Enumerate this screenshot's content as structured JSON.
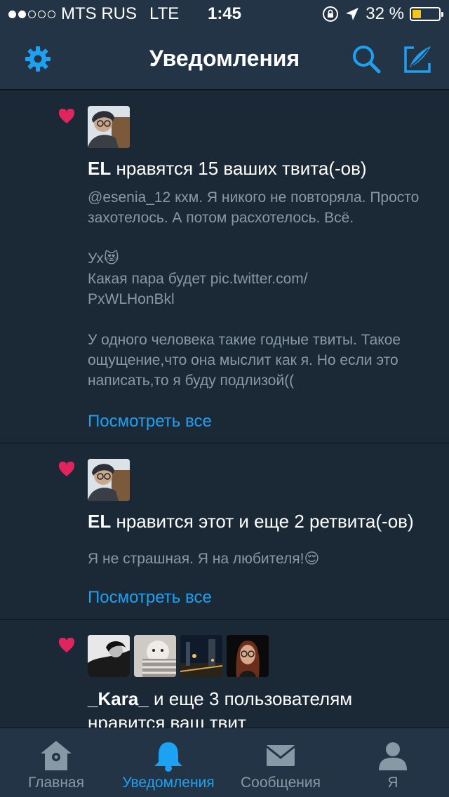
{
  "status_bar": {
    "carrier": "MTS RUS",
    "network": "LTE",
    "time": "1:45",
    "battery_percent": "32 %",
    "battery_level": 0.32,
    "signal_strength": 2,
    "signal_max": 5
  },
  "nav": {
    "title": "Уведомления",
    "settings_icon": "gear-icon",
    "search_icon": "search-icon",
    "compose_icon": "compose-icon"
  },
  "notifications": [
    {
      "user": "EL",
      "action": "нравятся 15 ваших твита(-ов)",
      "body": "@esenia_12  кхм. Я никого не повторяла. Просто захотелось. А потом расхотелось. Всё.\n\nУх😻\nКакая пара будет pic.twitter.com/\nPxWLHonBkl\n\nУ одного человека такие годные твиты. Такое ощущение,что она мыслит как я. Но если это написать,то я буду подлизой((",
      "see_all": "Посмотреть все"
    },
    {
      "user": "EL",
      "action": "нравится этот и еще 2 ретвита(-ов)",
      "body": "Я не страшная. Я на любителя!😌",
      "see_all": "Посмотреть все"
    },
    {
      "user": "_Kara_",
      "action": "и еще 3 пользователям нравится ваш твит"
    }
  ],
  "tabs": [
    {
      "label": "Главная",
      "icon": "home-icon"
    },
    {
      "label": "Уведомления",
      "icon": "bell-icon",
      "active": true
    },
    {
      "label": "Сообщения",
      "icon": "envelope-icon"
    },
    {
      "label": "Я",
      "icon": "profile-icon"
    }
  ],
  "colors": {
    "accent": "#1da1f2",
    "like": "#e0245e",
    "card_bg": "#1b2836",
    "bar_bg": "#243447",
    "secondary_text": "#8899a6"
  }
}
